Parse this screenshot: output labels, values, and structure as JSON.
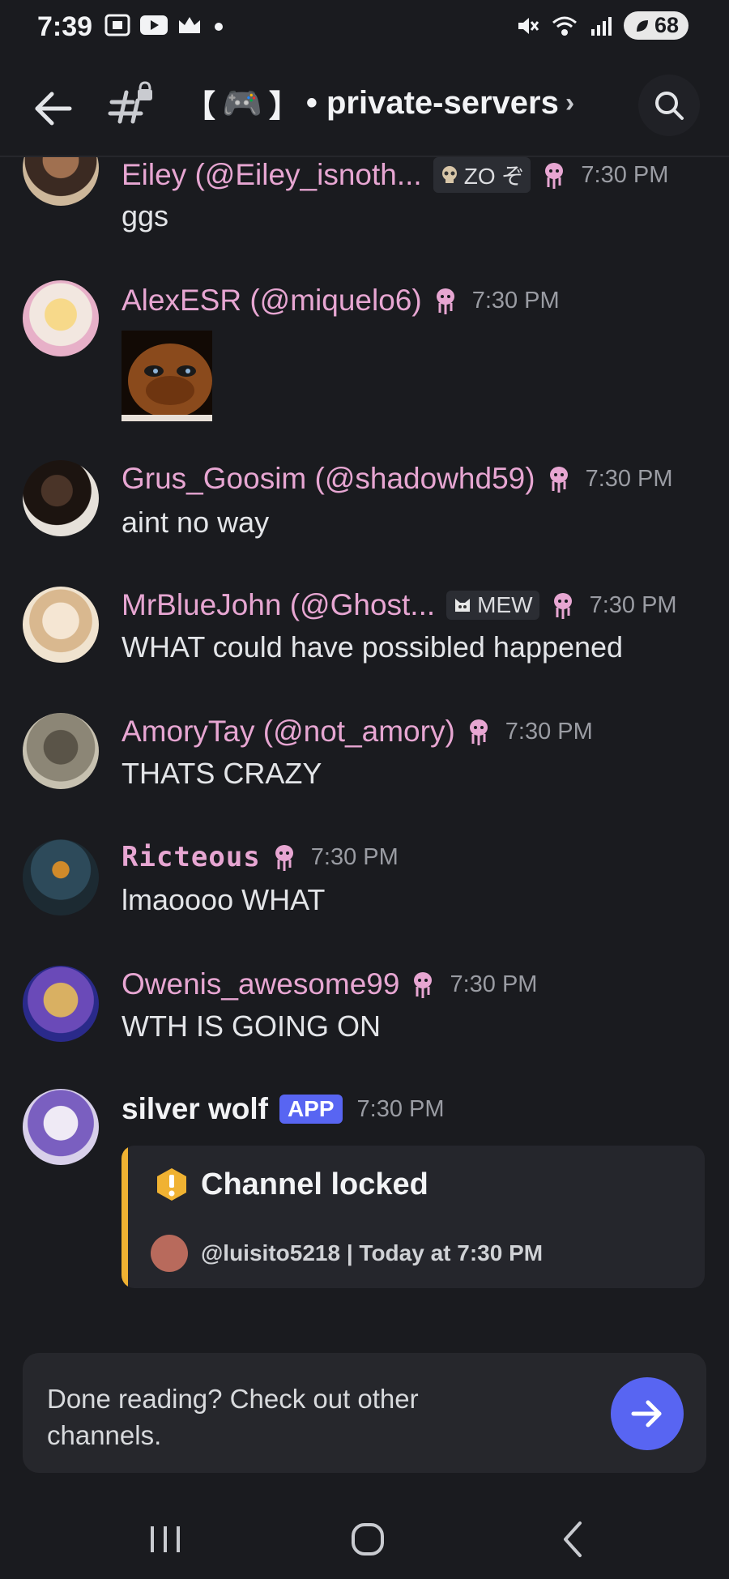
{
  "status_bar": {
    "time": "7:39",
    "battery": "68",
    "icons_left": [
      "screen-record-icon",
      "youtube-icon",
      "crown-icon",
      "dot-icon"
    ],
    "icons_right": [
      "mute-icon",
      "wifi-icon",
      "signal-icon",
      "battery-icon"
    ]
  },
  "header": {
    "bracket_open": "【",
    "bracket_close": "】",
    "channel_emoji": "🎮",
    "channel_name": "• private-servers",
    "chevron": "›"
  },
  "messages": [
    {
      "username": "Eiley (@Eiley_isnoth...",
      "tag": "ZO ぞ",
      "tag_icon": "skull-icon",
      "time": "7:30 PM",
      "text": "ggs"
    },
    {
      "username": "AlexESR (@miquelo6)",
      "time": "7:30 PM",
      "text": "",
      "attachment": "image"
    },
    {
      "username": "Grus_Goosim (@shadowhd59)",
      "time": "7:30 PM",
      "text": "aint no way"
    },
    {
      "username": "MrBlueJohn (@Ghost...",
      "tag": "MEW",
      "tag_icon": "cat-icon",
      "time": "7:30 PM",
      "text": "WHAT could have possibled happened"
    },
    {
      "username": "AmoryTay (@not_amory)",
      "time": "7:30 PM",
      "text": "THATS CRAZY"
    },
    {
      "username": "Ricteous",
      "time": "7:30 PM",
      "text": "lmaoooo WHAT"
    },
    {
      "username": "Owenis_awesome99",
      "time": "7:30 PM",
      "text": "WTH IS GOING ON"
    },
    {
      "username": "silver wolf",
      "badge": "APP",
      "time": "7:30 PM",
      "embed": {
        "title": "Channel locked",
        "footer": "@luisito5218 | Today at 7:30 PM"
      }
    }
  ],
  "done_bar": {
    "text": "Done reading? Check out other channels."
  },
  "colors": {
    "background": "#1a1b1f",
    "username": "#e7a6d2",
    "accent": "#5865f2",
    "embed_bar": "#f0b232"
  }
}
